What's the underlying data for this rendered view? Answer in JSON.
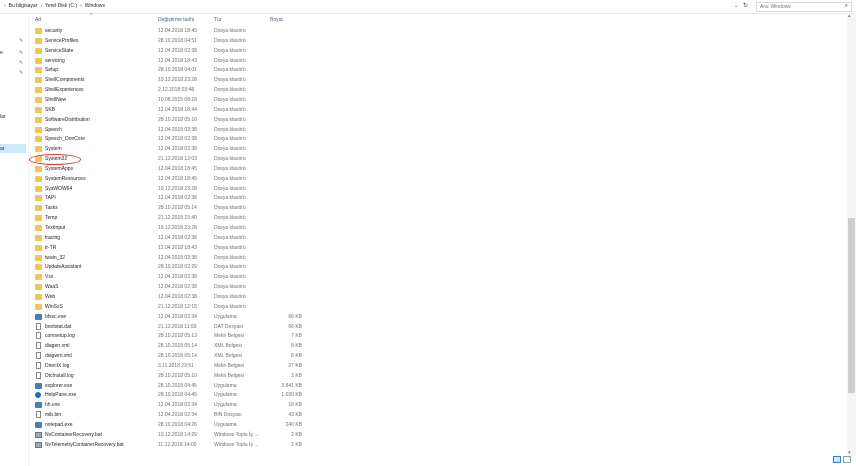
{
  "address": {
    "crumbs": [
      "Bu bilgisayar",
      "Yerel Disk (C:)",
      "Windows"
    ],
    "search_placeholder": "Ara: Windows"
  },
  "nav": {
    "items": [
      {
        "label": "",
        "pinned": true
      },
      {
        "label": "e",
        "pinned": true
      },
      {
        "label": "",
        "pinned": true
      },
      {
        "label": "",
        "pinned": true
      },
      {
        "label": "lar",
        "pinned": false
      },
      {
        "label": "ar",
        "pinned": false
      }
    ]
  },
  "columns": {
    "name": "Ad",
    "date": "Değiştirme tarihi",
    "type": "Tür",
    "size": "Boyut"
  },
  "rows": [
    {
      "name": "security",
      "date": "12.04.2018 18:45",
      "type": "Dosya klasörü",
      "size": "",
      "icon": "folder-icon"
    },
    {
      "name": "ServiceProfiles",
      "date": "28.10.2018 04:51",
      "type": "Dosya klasörü",
      "size": "",
      "icon": "folder-icon"
    },
    {
      "name": "ServiceState",
      "date": "12.04.2018 02:38",
      "type": "Dosya klasörü",
      "size": "",
      "icon": "folder-icon"
    },
    {
      "name": "servicing",
      "date": "12.04.2018 18:43",
      "type": "Dosya klasörü",
      "size": "",
      "icon": "folder-icon"
    },
    {
      "name": "Setup",
      "date": "28.10.2018 04:01",
      "type": "Dosya klasörü",
      "size": "",
      "icon": "folder-icon"
    },
    {
      "name": "ShellComponents",
      "date": "19.12.2018 23:28",
      "type": "Dosya klasörü",
      "size": "",
      "icon": "folder-icon"
    },
    {
      "name": "ShellExperiences",
      "date": "2.12.2018 03:48",
      "type": "Dosya klasörü",
      "size": "",
      "icon": "folder-icon"
    },
    {
      "name": "ShellNew",
      "date": "10.08.2015 08:18",
      "type": "Dosya klasörü",
      "size": "",
      "icon": "folder-icon"
    },
    {
      "name": "SKB",
      "date": "12.04.2018 18:44",
      "type": "Dosya klasörü",
      "size": "",
      "icon": "folder-icon"
    },
    {
      "name": "SoftwareDistribution",
      "date": "28.10.2018 05:16",
      "type": "Dosya klasörü",
      "size": "",
      "icon": "folder-icon"
    },
    {
      "name": "Speech",
      "date": "12.04.2018 02:38",
      "type": "Dosya klasörü",
      "size": "",
      "icon": "folder-icon"
    },
    {
      "name": "Speech_OneCore",
      "date": "12.04.2018 02:38",
      "type": "Dosya klasörü",
      "size": "",
      "icon": "folder-icon"
    },
    {
      "name": "System",
      "date": "12.04.2018 02:38",
      "type": "Dosya klasörü",
      "size": "",
      "icon": "folder-icon"
    },
    {
      "name": "System32",
      "date": "21.12.2018 12:03",
      "type": "Dosya klasörü",
      "size": "",
      "icon": "folder-icon"
    },
    {
      "name": "SystemApps",
      "date": "12.04.2018 18:45",
      "type": "Dosya klasörü",
      "size": "",
      "icon": "folder-icon"
    },
    {
      "name": "SystemResources",
      "date": "12.04.2018 18:45",
      "type": "Dosya klasörü",
      "size": "",
      "icon": "folder-icon"
    },
    {
      "name": "SysWOW64",
      "date": "19.12.2018 23:28",
      "type": "Dosya klasörü",
      "size": "",
      "icon": "folder-icon"
    },
    {
      "name": "TAPI",
      "date": "12.04.2018 02:38",
      "type": "Dosya klasörü",
      "size": "",
      "icon": "folder-icon"
    },
    {
      "name": "Tasks",
      "date": "28.10.2018 05:14",
      "type": "Dosya klasörü",
      "size": "",
      "icon": "folder-icon"
    },
    {
      "name": "Temp",
      "date": "21.12.2018 15:40",
      "type": "Dosya klasörü",
      "size": "",
      "icon": "folder-icon"
    },
    {
      "name": "TextInput",
      "date": "19.12.2018 23:28",
      "type": "Dosya klasörü",
      "size": "",
      "icon": "folder-icon"
    },
    {
      "name": "tracing",
      "date": "12.04.2018 02:38",
      "type": "Dosya klasörü",
      "size": "",
      "icon": "folder-icon"
    },
    {
      "name": "tr-TR",
      "date": "12.04.2018 18:43",
      "type": "Dosya klasörü",
      "size": "",
      "icon": "folder-icon"
    },
    {
      "name": "twain_32",
      "date": "12.04.2018 02:38",
      "type": "Dosya klasörü",
      "size": "",
      "icon": "folder-icon"
    },
    {
      "name": "UpdateAssistant",
      "date": "28.10.2018 02:29",
      "type": "Dosya klasörü",
      "size": "",
      "icon": "folder-icon"
    },
    {
      "name": "Vss",
      "date": "12.04.2018 02:38",
      "type": "Dosya klasörü",
      "size": "",
      "icon": "folder-icon"
    },
    {
      "name": "WaaS",
      "date": "12.04.2018 02:38",
      "type": "Dosya klasörü",
      "size": "",
      "icon": "folder-icon"
    },
    {
      "name": "Web",
      "date": "12.04.2018 02:38",
      "type": "Dosya klasörü",
      "size": "",
      "icon": "folder-icon"
    },
    {
      "name": "WinSxS",
      "date": "21.12.2018 12:15",
      "type": "Dosya klasörü",
      "size": "",
      "icon": "folder-icon"
    },
    {
      "name": "bfsvc.exe",
      "date": "12.04.2018 02:34",
      "type": "Uygulama",
      "size": "66 KB",
      "icon": "exe-icon"
    },
    {
      "name": "bootstat.dat",
      "date": "21.12.2018 11:59",
      "type": "DAT Dosyası",
      "size": "66 KB",
      "icon": "file-icon"
    },
    {
      "name": "comsetup.log",
      "date": "28.10.2018 05:13",
      "type": "Metin Belgesi",
      "size": "7 KB",
      "icon": "file-icon"
    },
    {
      "name": "diagerr.xml",
      "date": "28.10.2018 05:14",
      "type": "XML Belgesi",
      "size": "8 KB",
      "icon": "file-icon"
    },
    {
      "name": "diagwrn.xml",
      "date": "28.10.2018 05:14",
      "type": "XML Belgesi",
      "size": "8 KB",
      "icon": "file-icon"
    },
    {
      "name": "DirectX.log",
      "date": "3.11.2018 23:51",
      "type": "Metin Belgesi",
      "size": "27 KB",
      "icon": "file-icon"
    },
    {
      "name": "DtcInstall.log",
      "date": "28.10.2018 05:10",
      "type": "Metin Belgesi",
      "size": "3 KB",
      "icon": "file-icon"
    },
    {
      "name": "explorer.exe",
      "date": "28.10.2018 04:45",
      "type": "Uygulama",
      "size": "3.841 KB",
      "icon": "exe-icon"
    },
    {
      "name": "HelpPane.exe",
      "date": "28.10.2018 04:45",
      "type": "Uygulama",
      "size": "1.030 KB",
      "icon": "help-icon"
    },
    {
      "name": "hh.exe",
      "date": "12.04.2018 02:34",
      "type": "Uygulama",
      "size": "18 KB",
      "icon": "exe-icon"
    },
    {
      "name": "mib.bin",
      "date": "12.04.2018 02:34",
      "type": "BIN Dosyası",
      "size": "43 KB",
      "icon": "file-icon"
    },
    {
      "name": "notepad.exe",
      "date": "28.10.2018 04:26",
      "type": "Uygulama",
      "size": "240 KB",
      "icon": "exe-icon"
    },
    {
      "name": "NvContainerRecovery.bat",
      "date": "10.12.2018 14:29",
      "type": "Windows Toplu İş ...",
      "size": "2 KB",
      "icon": "bat-icon"
    },
    {
      "name": "NvTelemetryContainerRecovery.bat",
      "date": "11.12.2018 14:00",
      "type": "Windows Toplu İş ...",
      "size": "2 KB",
      "icon": "bat-icon"
    }
  ],
  "highlighted_item": "System32"
}
